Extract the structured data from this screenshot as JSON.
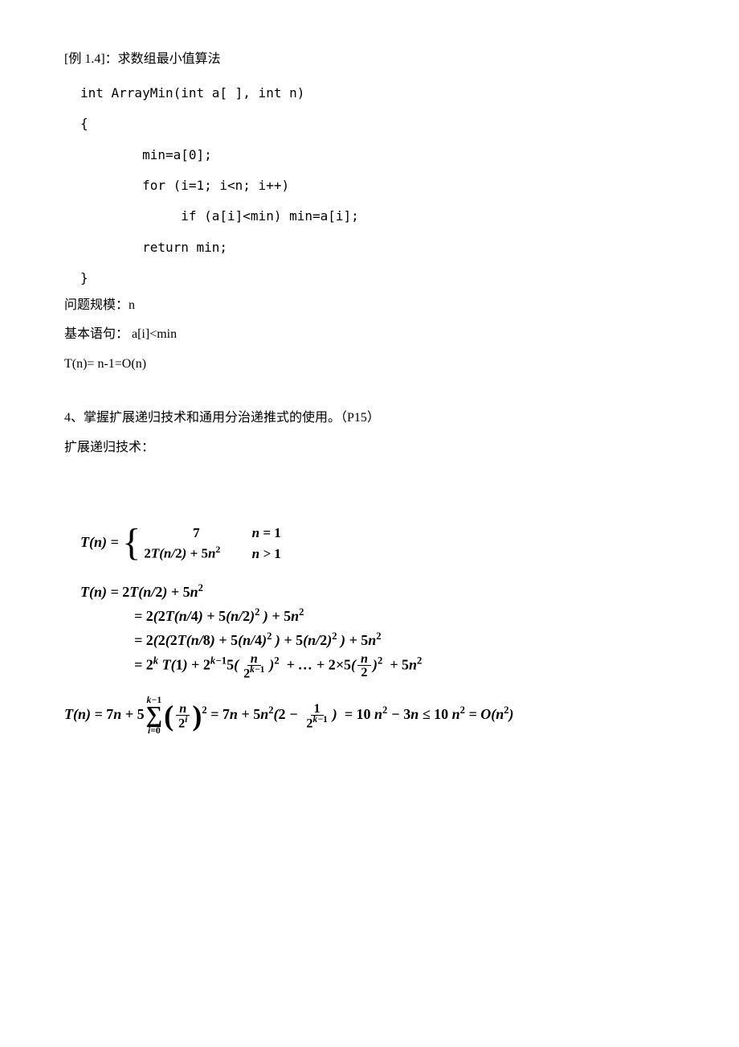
{
  "example": {
    "title": "[例 1.4]：求数组最小值算法",
    "code": {
      "sig": "int ArrayMin(int a[ ], int n)",
      "open": "{",
      "l1": "        min=a[0];",
      "l2": "        for (i=1; i<n; i++)",
      "l3": "             if (a[i]<min) min=a[i];",
      "l4": "        return min;",
      "close": "}"
    },
    "problem_size": "问题规模：n",
    "basic_stmt": "基本语句： a[i]<min",
    "tn": "T(n)= n-1=O(n)"
  },
  "section4": {
    "heading": "4、掌握扩展递归技术和通用分治递推式的使用。（P15）",
    "subtitle": "扩展递归技术："
  },
  "math": {
    "def": {
      "lhs": "T(n) = ",
      "case1_expr": "7",
      "case1_cond": "n = 1",
      "case2_expr": "2T(n/2) + 5n",
      "case2_cond": "n > 1"
    },
    "expand": {
      "l1": "T(n) = 2T(n/2) + 5n",
      "l2": "= 2(2T(n/4) + 5(n/2)",
      "l2b": " ) + 5n",
      "l3": "= 2(2(2T(n/8) + 5(n/4)",
      "l3b": " ) + 5(n/2)",
      "l3c": " ) + 5n",
      "l4a": "= 2",
      "l4b": " T(1) + 2",
      "l4c": "5(",
      "l4d": ")",
      "l4e": "  + … + 2×5(",
      "l4f": ")",
      "l4g": "  + 5n"
    },
    "final": {
      "a": "T(n) = 7n + 5",
      "b": " = 7n + 5n",
      "c": "(2 − ",
      "d": ")   = 10 n",
      "e": " − 3n ≤ 10 n",
      "f": " = O(n",
      "g": ")"
    }
  }
}
